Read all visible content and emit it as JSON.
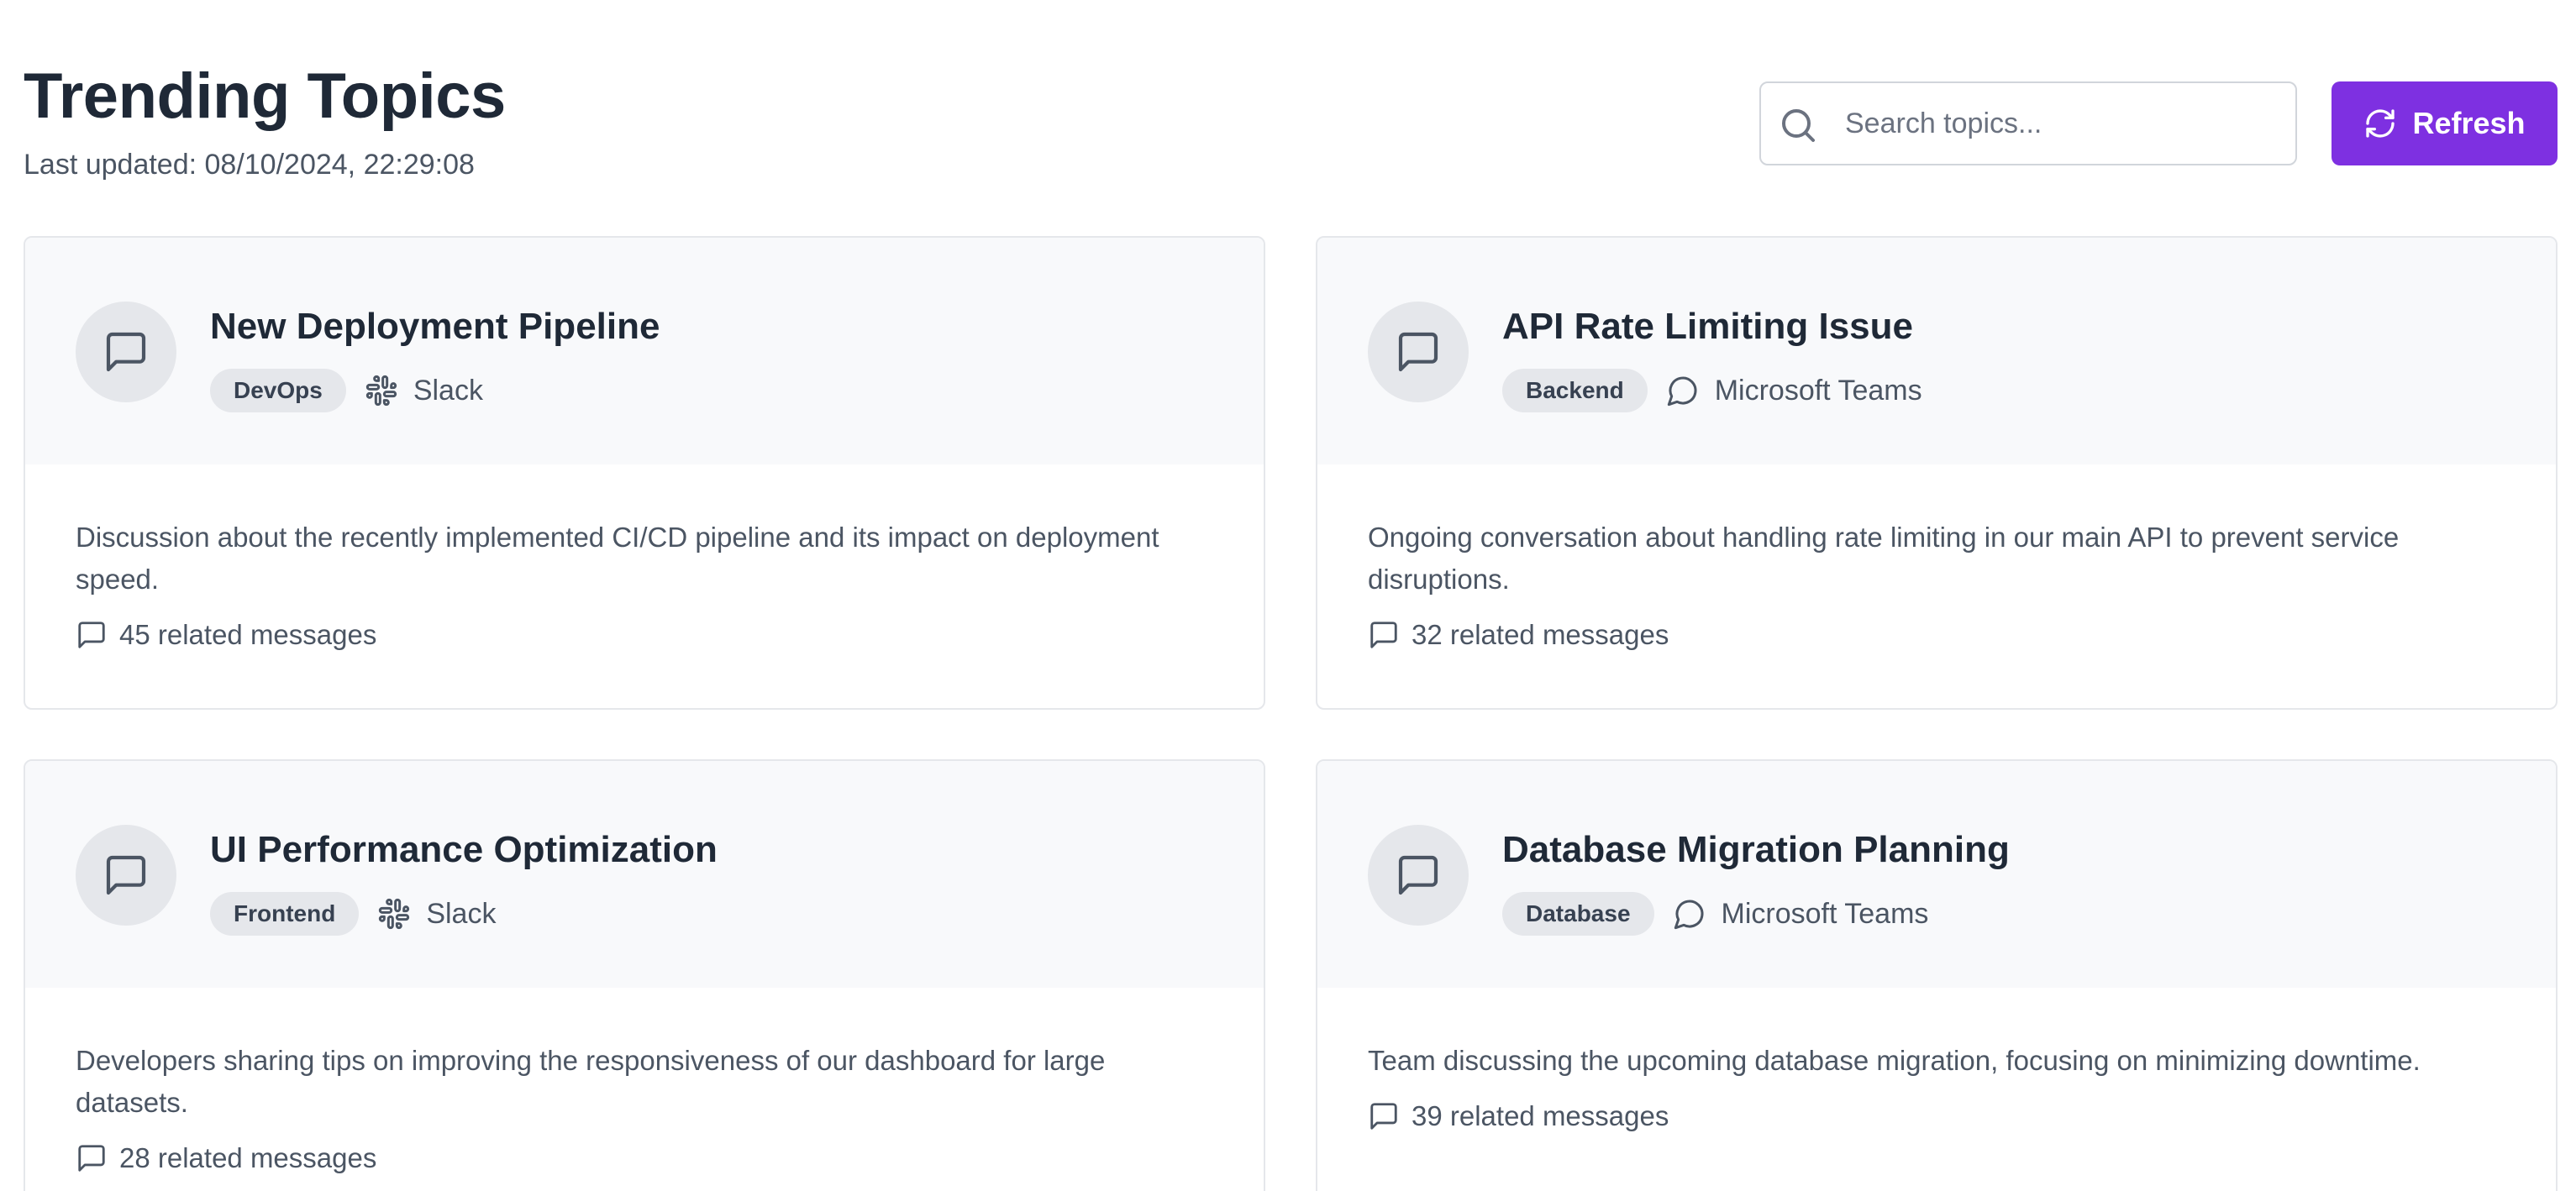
{
  "header": {
    "title": "Trending Topics",
    "last_updated": "Last updated: 08/10/2024, 22:29:08"
  },
  "search": {
    "placeholder": "Search topics...",
    "value": ""
  },
  "refresh_label": "Refresh",
  "colors": {
    "accent": "#7e30e1",
    "tag_bg": "#e5e7eb",
    "card_head_bg": "#f8f9fb"
  },
  "topics": [
    {
      "title": "New Deployment Pipeline",
      "tag": "DevOps",
      "platform": "Slack",
      "platform_icon": "slack-icon",
      "description": "Discussion about the recently implemented CI/CD pipeline and its impact on deployment speed.",
      "messages": "45 related messages"
    },
    {
      "title": "API Rate Limiting Issue",
      "tag": "Backend",
      "platform": "Microsoft Teams",
      "platform_icon": "chat-bubble-icon",
      "description": "Ongoing conversation about handling rate limiting in our main API to prevent service disruptions.",
      "messages": "32 related messages"
    },
    {
      "title": "UI Performance Optimization",
      "tag": "Frontend",
      "platform": "Slack",
      "platform_icon": "slack-icon",
      "description": "Developers sharing tips on improving the responsiveness of our dashboard for large datasets.",
      "messages": "28 related messages"
    },
    {
      "title": "Database Migration Planning",
      "tag": "Database",
      "platform": "Microsoft Teams",
      "platform_icon": "chat-bubble-icon",
      "description": "Team discussing the upcoming database migration, focusing on minimizing downtime.",
      "messages": "39 related messages"
    }
  ]
}
